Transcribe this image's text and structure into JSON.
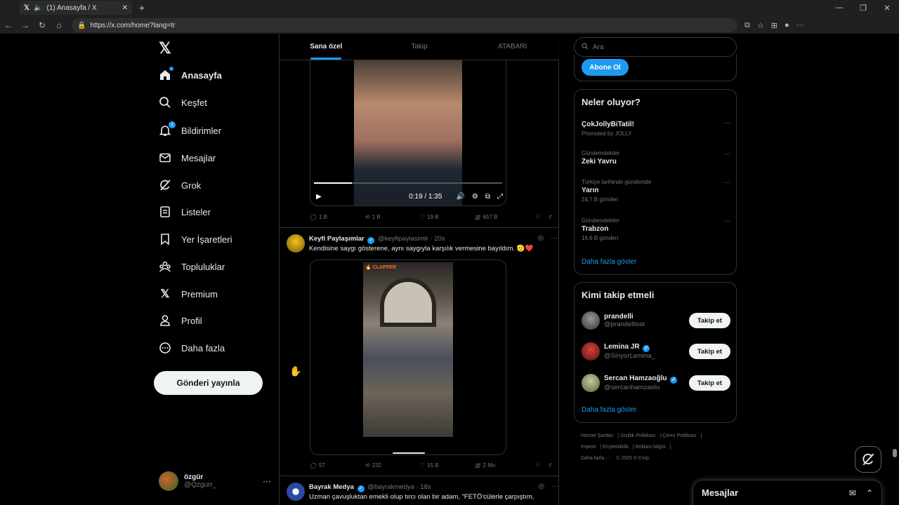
{
  "browser": {
    "tab_title": "(1) Anasayfa / X",
    "url": "https://x.com/home?lang=tr"
  },
  "nav": {
    "items": [
      {
        "label": "Anasayfa",
        "icon": "home-icon"
      },
      {
        "label": "Keşfet",
        "icon": "search-icon"
      },
      {
        "label": "Bildirimler",
        "icon": "bell-icon",
        "badge": "1"
      },
      {
        "label": "Mesajlar",
        "icon": "mail-icon"
      },
      {
        "label": "Grok",
        "icon": "grok-icon"
      },
      {
        "label": "Listeler",
        "icon": "list-icon"
      },
      {
        "label": "Yer İşaretleri",
        "icon": "bookmark-icon"
      },
      {
        "label": "Topluluklar",
        "icon": "communities-icon"
      },
      {
        "label": "Premium",
        "icon": "x-icon"
      },
      {
        "label": "Profil",
        "icon": "person-icon"
      },
      {
        "label": "Daha fazla",
        "icon": "more-circle-icon"
      }
    ],
    "post_button": "Gönderi yayınla",
    "profile": {
      "name": "özgür",
      "handle": "@Qzgurr_"
    }
  },
  "feed": {
    "tabs": [
      "Sana özel",
      "Takip",
      "ATABARI"
    ],
    "video1": {
      "time": "0:19 / 1:35",
      "progress": 0.2
    },
    "post1_stats": {
      "replies": "1 B",
      "reposts": "1 B",
      "likes": "19 B",
      "views": "657 B"
    },
    "post2": {
      "name": "Keyfi Paylaşımlar",
      "handle": "@keyfipaylasimlr",
      "time": "· 20s",
      "text": "Kendisine saygı gösterene, aynı saygıyla karşılık vermesine bayıldım. 🫡❤️",
      "clip_tag": "🔥 CLAPPER",
      "stats": {
        "replies": "57",
        "reposts": "232",
        "likes": "15 B",
        "views": "2 Mn"
      }
    },
    "post3": {
      "name": "Bayrak Medya",
      "handle": "@bayrakmedya",
      "time": "· 18s",
      "text": "Uzman çavuşluktan emekli olup tırcı olan bir adam, \"FETÖ'cülerle çarpıştım,"
    }
  },
  "sidebar": {
    "search_placeholder": "Ara",
    "subscribe_button": "Abone Ol",
    "trends_title": "Neler oluyor?",
    "trends": [
      {
        "context": "",
        "title": "ÇokJollyBiTatil!",
        "count": "Promoted by JOLLY"
      },
      {
        "context": "Gündemdekiler",
        "title": "Zeki Yavru",
        "count": ""
      },
      {
        "context": "Türkiye tarihinde gündemde",
        "title": "Yarın",
        "count": "24,7 B gönderi"
      },
      {
        "context": "Gündemdekiler",
        "title": "Trabzon",
        "count": "16,6 B gönderi"
      }
    ],
    "show_more": "Daha fazla göster",
    "who_title": "Kimi takip etmeli",
    "who": [
      {
        "name": "prandelli",
        "handle": "@prandellisst",
        "verified": false
      },
      {
        "name": "Lemina JR",
        "handle": "@SinyorLemina_",
        "verified": true
      },
      {
        "name": "Sercan Hamzaoğlu",
        "handle": "@sercanhamzaolu",
        "verified": true
      }
    ],
    "follow_label": "Takip et",
    "footer": [
      "Hizmet Şartları",
      "Gizlilik Politikası",
      "Çerez Politikası",
      "Imprint",
      "Erişilebilirlik",
      "Reklam bilgisi",
      "Daha fazla ···",
      "© 2025 X Corp."
    ]
  },
  "messages_drawer": {
    "title": "Mesajlar"
  }
}
